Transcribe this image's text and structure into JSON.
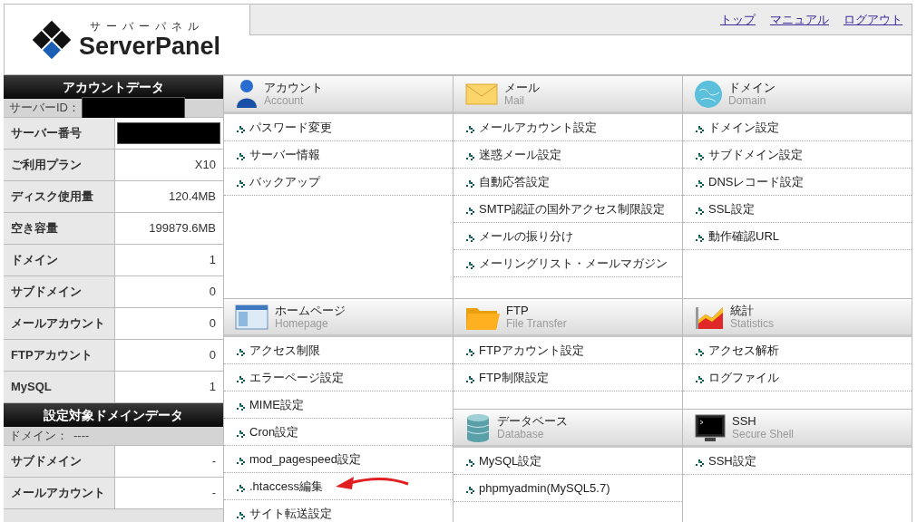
{
  "header": {
    "logo_kana": "サーバーパネル",
    "logo": "ServerPanel",
    "links": [
      "トップ",
      "マニュアル",
      "ログアウト"
    ]
  },
  "side_panels": [
    {
      "title": "アカウントデータ",
      "info_row": {
        "label": "サーバーID：",
        "redacted": true
      },
      "rows": [
        {
          "label": "サーバー番号",
          "redacted": true
        },
        {
          "label": "ご利用プラン",
          "value": "X10"
        },
        {
          "label": "ディスク使用量",
          "value": "120.4MB"
        },
        {
          "label": "空き容量",
          "value": "199879.6MB"
        },
        {
          "label": "ドメイン",
          "value": "1"
        },
        {
          "label": "サブドメイン",
          "value": "0"
        },
        {
          "label": "メールアカウント",
          "value": "0"
        },
        {
          "label": "FTPアカウント",
          "value": "0"
        },
        {
          "label": "MySQL",
          "value": "1"
        }
      ]
    },
    {
      "title": "設定対象ドメインデータ",
      "info_row": {
        "label": "ドメイン：",
        "value": "----"
      },
      "rows": [
        {
          "label": "サブドメイン",
          "value": "-"
        },
        {
          "label": "メールアカウント",
          "value": "-"
        }
      ]
    }
  ],
  "columns": [
    [
      {
        "title": "アカウント",
        "subtitle": "Account",
        "items": [
          "パスワード変更",
          "サーバー情報",
          "バックアップ"
        ]
      },
      {
        "title": "ホームページ",
        "subtitle": "Homepage",
        "items": [
          "アクセス制限",
          "エラーページ設定",
          "MIME設定",
          "Cron設定",
          "mod_pagespeed設定",
          ".htaccess編集",
          "サイト転送設定"
        ]
      }
    ],
    [
      {
        "title": "メール",
        "subtitle": "Mail",
        "items": [
          "メールアカウント設定",
          "迷惑メール設定",
          "自動応答設定",
          "SMTP認証の国外アクセス制限設定",
          "メールの振り分け",
          "メーリングリスト・メールマガジン"
        ]
      },
      {
        "title": "FTP",
        "subtitle": "File Transfer",
        "items": [
          "FTPアカウント設定",
          "FTP制限設定"
        ]
      },
      {
        "title": "データベース",
        "subtitle": "Database",
        "items": [
          "MySQL設定",
          "phpmyadmin(MySQL5.7)"
        ]
      }
    ],
    [
      {
        "title": "ドメイン",
        "subtitle": "Domain",
        "items": [
          "ドメイン設定",
          "サブドメイン設定",
          "DNSレコード設定",
          "SSL設定",
          "動作確認URL"
        ]
      },
      {
        "title": "統計",
        "subtitle": "Statistics",
        "items": [
          "アクセス解析",
          "ログファイル"
        ]
      },
      {
        "title": "SSH",
        "subtitle": "Secure Shell",
        "items": [
          "SSH設定"
        ]
      }
    ]
  ]
}
